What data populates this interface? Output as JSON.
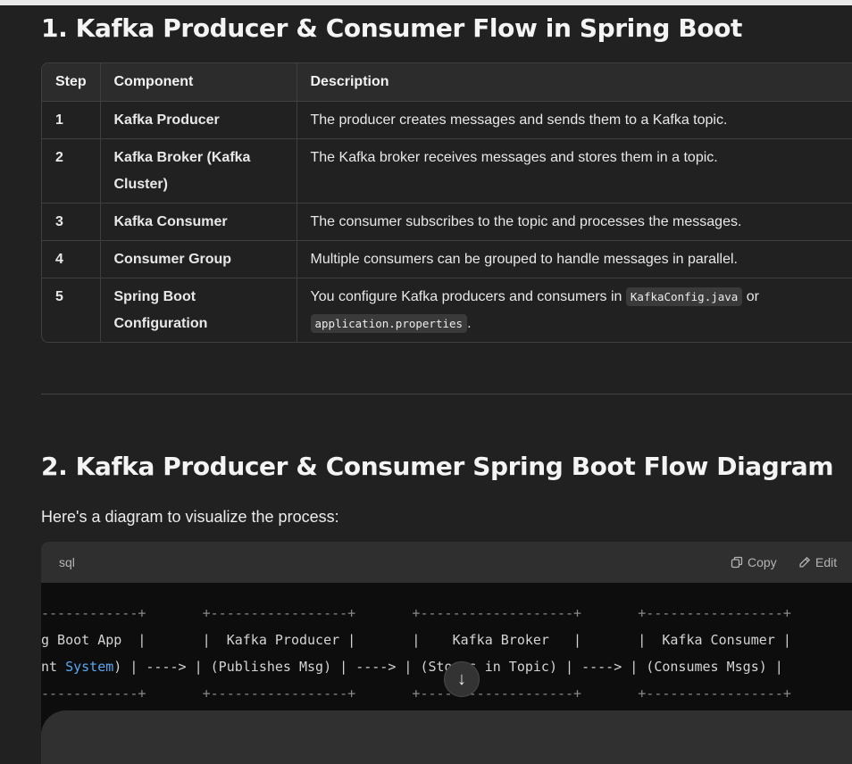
{
  "section1": {
    "title": "1. Kafka Producer & Consumer Flow in Spring Boot"
  },
  "table": {
    "headers": [
      "Step",
      "Component",
      "Description"
    ],
    "rows": [
      {
        "step": "1",
        "component": "Kafka Producer",
        "description": "The producer creates messages and sends them to a Kafka topic."
      },
      {
        "step": "2",
        "component": "Kafka Broker (Kafka Cluster)",
        "description": "The Kafka broker receives messages and stores them in a topic."
      },
      {
        "step": "3",
        "component": "Kafka Consumer",
        "description": "The consumer subscribes to the topic and processes the messages."
      },
      {
        "step": "4",
        "component": "Consumer Group",
        "description": "Multiple consumers can be grouped to handle messages in parallel."
      },
      {
        "step": "5",
        "component": "Spring Boot Configuration",
        "description_pre": "You configure Kafka producers and consumers in ",
        "code1": "KafkaConfig.java",
        "description_mid": " or ",
        "code2": "application.properties",
        "description_post": "."
      }
    ]
  },
  "section2": {
    "title": "2. Kafka Producer & Consumer Spring Boot Flow Diagram",
    "intro": "Here's a diagram to visualize the process:"
  },
  "codeblock": {
    "language": "sql",
    "copy_label": "Copy",
    "edit_label": "Edit",
    "lines": {
      "border": "------------+       +-----------------+       +-------------------+       +-----------------+",
      "row1": "g Boot App  |       |  Kafka Producer |       |    Kafka Broker   |       |  Kafka Consumer |",
      "row2_a": "nt ",
      "row2_kw": "System",
      "row2_b": ") | ----> | (Publishes Msg) | ----> | (Stores in Topic) | ----> | (Consumes Msgs) |"
    }
  },
  "scroll_down_icon": "arrow-down-icon"
}
